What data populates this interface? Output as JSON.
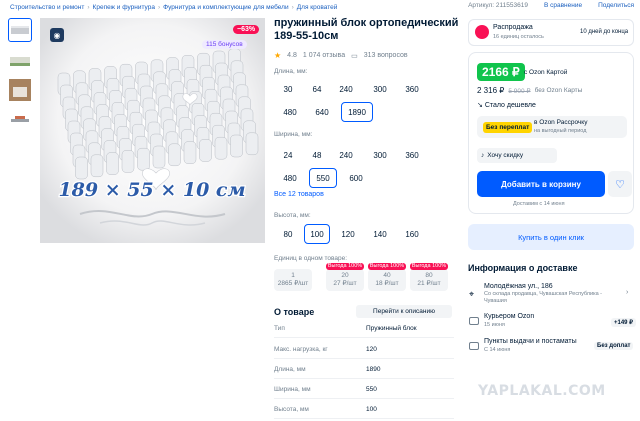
{
  "breadcrumbs": [
    "Строительство и ремонт",
    "Крепеж и фурнитура",
    "Фурнитура и комплектующие для мебели",
    "Для кроватей"
  ],
  "top_links": {
    "article": "Артикул: 211553619",
    "compare": "В сравнение",
    "share": "Поделиться"
  },
  "product": {
    "title": "пружинный блок ортопедический 189-55-10см",
    "rating": "4.8",
    "reviews": "1 074 отзыва",
    "questions": "313 вопросов",
    "discount_badge": "−63%",
    "bonus_badge": "115 бонусов",
    "image_caption": "189 × 55 × 10 см"
  },
  "length": {
    "label": "Длина, мм:",
    "options": [
      "30",
      "64",
      "240",
      "300",
      "360",
      "480",
      "640",
      "1890"
    ],
    "selected": "1890"
  },
  "width": {
    "label": "Ширина, мм:",
    "options": [
      "24",
      "48",
      "240",
      "300",
      "360",
      "480",
      "550",
      "600"
    ],
    "selected": "550",
    "more_link": "Все 12 товаров"
  },
  "height": {
    "label": "Высота, мм:",
    "options": [
      "80",
      "100",
      "120",
      "140",
      "160"
    ],
    "selected": "100"
  },
  "units": {
    "label": "Единиц в одном товаре:",
    "items": [
      {
        "count": "1",
        "price": "2865 ₽/шт",
        "tag": ""
      },
      {
        "count": "20",
        "price": "27 ₽/шт",
        "tag": "Выгода 100%"
      },
      {
        "count": "40",
        "price": "18 ₽/шт",
        "tag": "Выгода 100%"
      },
      {
        "count": "80",
        "price": "21 ₽/шт",
        "tag": "Выгода 100%"
      }
    ]
  },
  "about": {
    "title": "О товаре",
    "to_description": "Перейти к описанию",
    "rows": [
      {
        "k": "Тип",
        "v": "Пружинный блок"
      },
      {
        "k": "Макс. нагрузка, кг",
        "v": "120"
      },
      {
        "k": "Длина, мм",
        "v": "1890"
      },
      {
        "k": "Ширина, мм",
        "v": "550"
      },
      {
        "k": "Высота, мм",
        "v": "100"
      }
    ]
  },
  "sale": {
    "title": "Распродажа",
    "subtitle": "16 единиц осталось",
    "days": "10 дней до конца"
  },
  "price": {
    "card_price": "2166 ₽",
    "card_label": "с Ozon Картой",
    "regular_price": "2 316 ₽",
    "old_price": "5 900 ₽",
    "regular_label": "без Ozon Карты",
    "cheaper": "Стало дешевле",
    "installment_tag": "Без переплат",
    "installment_title": "в Ozon Рассрочку",
    "installment_sub": "на выгодный период",
    "wish": "Хочу скидку",
    "add_to_cart": "Добавить в корзину",
    "delivery_note": "Доставим с 14 июня"
  },
  "buy_one_click": "Купить в один клик",
  "delivery": {
    "title": "Информация о доставке",
    "address": "Молодёжная ул., 186",
    "address_sub": "Со склада продавца, Чувашская Республика - Чувашия",
    "courier": "Курьером Ozon",
    "courier_date": "15 июня",
    "courier_price": "+149 ₽",
    "pickup": "Пункты выдачи и постаматы",
    "pickup_date": "С 14 июня",
    "pickup_price": "Без доплат"
  },
  "watermark": "YAPLAKAL.COM",
  "colors": {
    "accent": "#005bff",
    "green": "#10c44c",
    "pink": "#f91155"
  }
}
